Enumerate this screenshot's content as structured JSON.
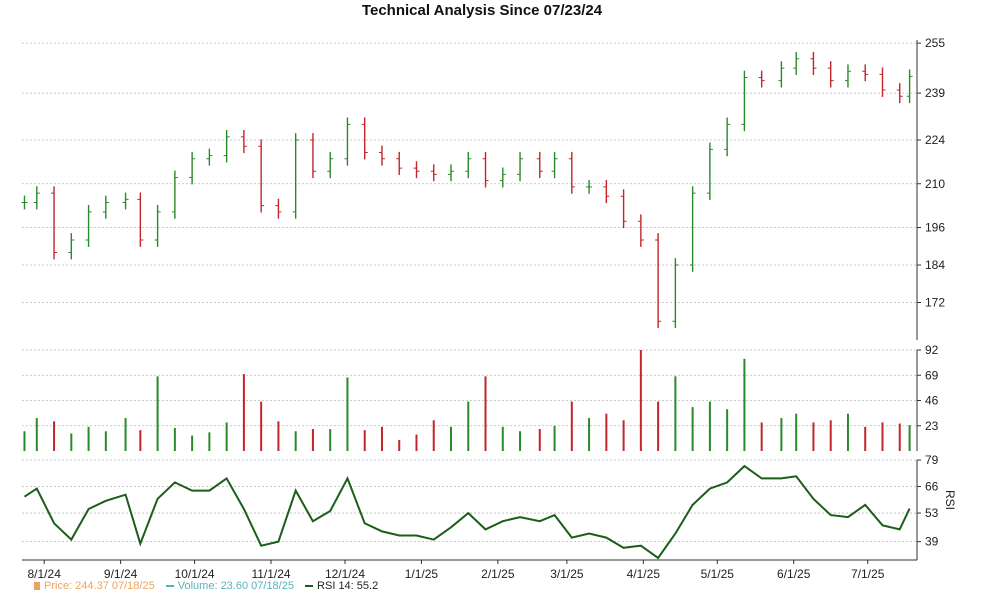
{
  "chart_data": {
    "type": "line",
    "title": "Technical Analysis Since 07/23/24",
    "x_tick_labels": [
      "8/1/24",
      "9/1/24",
      "10/1/24",
      "11/1/24",
      "12/1/24",
      "1/1/25",
      "2/1/25",
      "3/1/25",
      "4/1/25",
      "5/1/25",
      "6/1/25",
      "7/1/25"
    ],
    "price_panel": {
      "y_ticks": [
        255,
        239,
        224,
        210,
        196,
        184,
        172
      ],
      "ylim": [
        160,
        256
      ],
      "grid": true,
      "series": [
        {
          "x": "7/24/24",
          "y": 204
        },
        {
          "x": "7/29/24",
          "y": 207
        },
        {
          "x": "8/5/24",
          "y": 188
        },
        {
          "x": "8/12/24",
          "y": 192
        },
        {
          "x": "8/19/24",
          "y": 201
        },
        {
          "x": "8/26/24",
          "y": 204
        },
        {
          "x": "9/3/24",
          "y": 205
        },
        {
          "x": "9/9/24",
          "y": 192
        },
        {
          "x": "9/16/24",
          "y": 201
        },
        {
          "x": "9/23/24",
          "y": 212
        },
        {
          "x": "9/30/24",
          "y": 218
        },
        {
          "x": "10/7/24",
          "y": 219
        },
        {
          "x": "10/14/24",
          "y": 225
        },
        {
          "x": "10/21/24",
          "y": 222
        },
        {
          "x": "10/28/24",
          "y": 203
        },
        {
          "x": "11/4/24",
          "y": 201
        },
        {
          "x": "11/11/24",
          "y": 224
        },
        {
          "x": "11/18/24",
          "y": 214
        },
        {
          "x": "11/25/24",
          "y": 218
        },
        {
          "x": "12/2/24",
          "y": 229
        },
        {
          "x": "12/9/24",
          "y": 220
        },
        {
          "x": "12/16/24",
          "y": 218
        },
        {
          "x": "12/23/24",
          "y": 215
        },
        {
          "x": "12/30/24",
          "y": 214
        },
        {
          "x": "1/6/25",
          "y": 213
        },
        {
          "x": "1/13/25",
          "y": 214
        },
        {
          "x": "1/20/25",
          "y": 218
        },
        {
          "x": "1/27/25",
          "y": 211
        },
        {
          "x": "2/3/25",
          "y": 213
        },
        {
          "x": "2/10/25",
          "y": 218
        },
        {
          "x": "2/18/25",
          "y": 214
        },
        {
          "x": "2/24/25",
          "y": 218
        },
        {
          "x": "3/3/25",
          "y": 209
        },
        {
          "x": "3/10/25",
          "y": 209
        },
        {
          "x": "3/17/25",
          "y": 206
        },
        {
          "x": "3/24/25",
          "y": 198
        },
        {
          "x": "3/31/25",
          "y": 192
        },
        {
          "x": "4/7/25",
          "y": 166
        },
        {
          "x": "4/14/25",
          "y": 184
        },
        {
          "x": "4/21/25",
          "y": 207
        },
        {
          "x": "4/28/25",
          "y": 221
        },
        {
          "x": "5/5/25",
          "y": 229
        },
        {
          "x": "5/12/25",
          "y": 244
        },
        {
          "x": "5/19/25",
          "y": 243
        },
        {
          "x": "5/27/25",
          "y": 247
        },
        {
          "x": "6/2/25",
          "y": 250
        },
        {
          "x": "6/9/25",
          "y": 247
        },
        {
          "x": "6/16/25",
          "y": 243
        },
        {
          "x": "6/23/25",
          "y": 246
        },
        {
          "x": "6/30/25",
          "y": 245
        },
        {
          "x": "7/7/25",
          "y": 240
        },
        {
          "x": "7/14/25",
          "y": 238
        },
        {
          "x": "7/18/25",
          "y": 244.37
        }
      ]
    },
    "volume_panel": {
      "y_ticks": [
        92,
        69,
        46,
        23
      ],
      "ylim": [
        0,
        92
      ],
      "grid": true,
      "bars": [
        {
          "x": "7/24/24",
          "y": 18
        },
        {
          "x": "7/29/24",
          "y": 30
        },
        {
          "x": "8/5/24",
          "y": 27
        },
        {
          "x": "8/12/24",
          "y": 16
        },
        {
          "x": "8/19/24",
          "y": 22
        },
        {
          "x": "8/26/24",
          "y": 18
        },
        {
          "x": "9/3/24",
          "y": 30
        },
        {
          "x": "9/9/24",
          "y": 19
        },
        {
          "x": "9/16/24",
          "y": 68
        },
        {
          "x": "9/23/24",
          "y": 21
        },
        {
          "x": "9/30/24",
          "y": 14
        },
        {
          "x": "10/7/24",
          "y": 17
        },
        {
          "x": "10/14/24",
          "y": 26
        },
        {
          "x": "10/21/24",
          "y": 70
        },
        {
          "x": "10/28/24",
          "y": 45
        },
        {
          "x": "11/4/24",
          "y": 27
        },
        {
          "x": "11/11/24",
          "y": 18
        },
        {
          "x": "11/18/24",
          "y": 20
        },
        {
          "x": "11/25/24",
          "y": 20
        },
        {
          "x": "12/2/24",
          "y": 67
        },
        {
          "x": "12/9/24",
          "y": 19
        },
        {
          "x": "12/16/24",
          "y": 22
        },
        {
          "x": "12/23/24",
          "y": 10
        },
        {
          "x": "12/30/24",
          "y": 15
        },
        {
          "x": "1/6/25",
          "y": 28
        },
        {
          "x": "1/13/25",
          "y": 22
        },
        {
          "x": "1/20/25",
          "y": 45
        },
        {
          "x": "1/27/25",
          "y": 68
        },
        {
          "x": "2/3/25",
          "y": 22
        },
        {
          "x": "2/10/25",
          "y": 18
        },
        {
          "x": "2/18/25",
          "y": 20
        },
        {
          "x": "2/24/25",
          "y": 23
        },
        {
          "x": "3/3/25",
          "y": 45
        },
        {
          "x": "3/10/25",
          "y": 30
        },
        {
          "x": "3/17/25",
          "y": 34
        },
        {
          "x": "3/24/25",
          "y": 28
        },
        {
          "x": "3/31/25",
          "y": 92
        },
        {
          "x": "4/7/25",
          "y": 45
        },
        {
          "x": "4/14/25",
          "y": 68
        },
        {
          "x": "4/21/25",
          "y": 40
        },
        {
          "x": "4/28/25",
          "y": 45
        },
        {
          "x": "5/5/25",
          "y": 38
        },
        {
          "x": "5/12/25",
          "y": 84
        },
        {
          "x": "5/19/25",
          "y": 26
        },
        {
          "x": "5/27/25",
          "y": 30
        },
        {
          "x": "6/2/25",
          "y": 34
        },
        {
          "x": "6/9/25",
          "y": 26
        },
        {
          "x": "6/16/25",
          "y": 28
        },
        {
          "x": "6/23/25",
          "y": 34
        },
        {
          "x": "6/30/25",
          "y": 22
        },
        {
          "x": "7/7/25",
          "y": 26
        },
        {
          "x": "7/14/25",
          "y": 25
        },
        {
          "x": "7/18/25",
          "y": 23.6
        }
      ]
    },
    "rsi_panel": {
      "y_ticks": [
        79,
        66,
        53,
        39
      ],
      "ylim": [
        30,
        79
      ],
      "ylabel": "RSI",
      "grid": true,
      "series": [
        {
          "x": "7/24/24",
          "y": 61
        },
        {
          "x": "7/29/24",
          "y": 65
        },
        {
          "x": "8/5/24",
          "y": 48
        },
        {
          "x": "8/12/24",
          "y": 40
        },
        {
          "x": "8/19/24",
          "y": 55
        },
        {
          "x": "8/26/24",
          "y": 59
        },
        {
          "x": "9/3/24",
          "y": 62
        },
        {
          "x": "9/9/24",
          "y": 38
        },
        {
          "x": "9/16/24",
          "y": 60
        },
        {
          "x": "9/23/24",
          "y": 68
        },
        {
          "x": "9/30/24",
          "y": 64
        },
        {
          "x": "10/7/24",
          "y": 64
        },
        {
          "x": "10/14/24",
          "y": 70
        },
        {
          "x": "10/21/24",
          "y": 55
        },
        {
          "x": "10/28/24",
          "y": 37
        },
        {
          "x": "11/4/24",
          "y": 39
        },
        {
          "x": "11/11/24",
          "y": 64
        },
        {
          "x": "11/18/24",
          "y": 49
        },
        {
          "x": "11/25/24",
          "y": 54
        },
        {
          "x": "12/2/24",
          "y": 70
        },
        {
          "x": "12/9/24",
          "y": 48
        },
        {
          "x": "12/16/24",
          "y": 44
        },
        {
          "x": "12/23/24",
          "y": 42
        },
        {
          "x": "12/30/24",
          "y": 42
        },
        {
          "x": "1/6/25",
          "y": 40
        },
        {
          "x": "1/13/25",
          "y": 46
        },
        {
          "x": "1/20/25",
          "y": 53
        },
        {
          "x": "1/27/25",
          "y": 45
        },
        {
          "x": "2/3/25",
          "y": 49
        },
        {
          "x": "2/10/25",
          "y": 51
        },
        {
          "x": "2/18/25",
          "y": 49
        },
        {
          "x": "2/24/25",
          "y": 52
        },
        {
          "x": "3/3/25",
          "y": 41
        },
        {
          "x": "3/10/25",
          "y": 43
        },
        {
          "x": "3/17/25",
          "y": 41
        },
        {
          "x": "3/24/25",
          "y": 36
        },
        {
          "x": "3/31/25",
          "y": 37
        },
        {
          "x": "4/7/25",
          "y": 31
        },
        {
          "x": "4/14/25",
          "y": 43
        },
        {
          "x": "4/21/25",
          "y": 57
        },
        {
          "x": "4/28/25",
          "y": 65
        },
        {
          "x": "5/5/25",
          "y": 68
        },
        {
          "x": "5/12/25",
          "y": 76
        },
        {
          "x": "5/19/25",
          "y": 70
        },
        {
          "x": "5/27/25",
          "y": 70
        },
        {
          "x": "6/2/25",
          "y": 71
        },
        {
          "x": "6/9/25",
          "y": 60
        },
        {
          "x": "6/16/25",
          "y": 52
        },
        {
          "x": "6/23/25",
          "y": 51
        },
        {
          "x": "6/30/25",
          "y": 57
        },
        {
          "x": "7/7/25",
          "y": 47
        },
        {
          "x": "7/14/25",
          "y": 45
        },
        {
          "x": "7/18/25",
          "y": 55.2
        }
      ]
    },
    "legend_items": [
      {
        "label": "Price: 244.37  07/18/25",
        "color": "#f0a35e",
        "mark": "swatch"
      },
      {
        "label": "Volume: 23.60  07/18/25",
        "color": "#57b3b8",
        "mark": "dash"
      },
      {
        "label": "RSI 14: 55.2",
        "color": "#1a5e1a",
        "mark": "rsi"
      }
    ],
    "colors": {
      "up": "#2a8a2a",
      "down": "#c0262c",
      "rsi_line": "#1a5e1a",
      "grid": "#bbbbbb",
      "axis": "#333333"
    }
  }
}
